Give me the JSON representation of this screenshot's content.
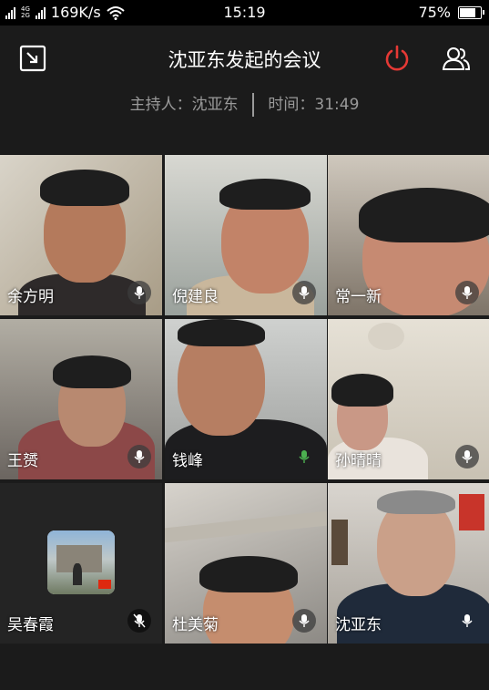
{
  "status_bar": {
    "net_labels": [
      "2G",
      "4G",
      "2G"
    ],
    "speed": "169K/s",
    "time": "15:19",
    "battery_percent": "75%",
    "battery_level": 0.75
  },
  "header": {
    "title": "沈亚东发起的会议",
    "accent": "#e53935"
  },
  "meeting_info": {
    "host_label": "主持人：沈亚东",
    "duration_label": "时间：31:49"
  },
  "participants": [
    {
      "name": "余方明",
      "speaking": false
    },
    {
      "name": "倪建良",
      "speaking": false
    },
    {
      "name": "常一新",
      "speaking": false
    },
    {
      "name": "王赟",
      "speaking": false
    },
    {
      "name": "钱峰",
      "speaking": true
    },
    {
      "name": "孙晴晴",
      "speaking": false
    },
    {
      "name": "吴春霞",
      "speaking": false,
      "muted": true,
      "video": false
    },
    {
      "name": "杜美菊",
      "speaking": false
    },
    {
      "name": "沈亚东",
      "speaking": false
    }
  ],
  "colors": {
    "background": "#1b1b1b",
    "speaking_mic": "#4caf50"
  }
}
